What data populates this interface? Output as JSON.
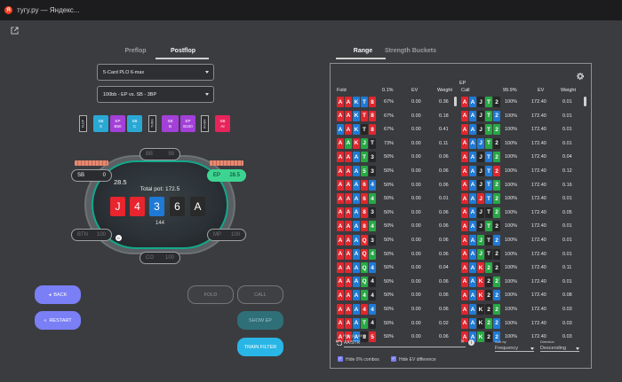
{
  "window": {
    "title": "тугу.ру — Яндекс...",
    "logo": "Я"
  },
  "tabs": {
    "preflop": "Preflop",
    "postflop": "Postflop",
    "range": "Range",
    "buckets": "Strength Buckets"
  },
  "selects": {
    "game": "5-Card PLO 6-max",
    "spot": "100bb - EP vs. SB - 3BP"
  },
  "actions": {
    "flop": "FLOP",
    "turn": "TURN",
    "river": "RIVER",
    "items": [
      {
        "l1": "SB",
        "l2": "X",
        "color": "#2aa8d4"
      },
      {
        "l1": "EP",
        "l2": "B50",
        "color": "#a340d8"
      },
      {
        "l1": "SB",
        "l2": "C",
        "color": "#2aa8d4"
      },
      {
        "l1": "SB",
        "l2": "B",
        "color": "#a340d8"
      },
      {
        "l1": "EP",
        "l2": "B100",
        "color": "#a340d8"
      },
      {
        "l1": "EP",
        "l2": "C",
        "color": "#2aa8d4"
      },
      {
        "l1": "SB",
        "l2": "AI",
        "color": "#e8245a"
      }
    ]
  },
  "seats": {
    "bb": {
      "name": "BB",
      "stack": "99"
    },
    "sb": {
      "name": "SB",
      "stack": "0"
    },
    "ep": {
      "name": "EP",
      "stack": "28.5"
    },
    "bth": {
      "name": "BTN",
      "stack": "100"
    },
    "mp": {
      "name": "MP",
      "stack": "100"
    },
    "co": {
      "name": "CO",
      "stack": "100"
    }
  },
  "table": {
    "left_bet": "28.5",
    "pot_label": "Total pot: 172.5",
    "pot": "144",
    "dealer": "D",
    "board": [
      {
        "r": "J",
        "c": "#e8242e"
      },
      {
        "r": "4",
        "c": "#e8242e"
      },
      {
        "r": "3",
        "c": "#1f7ad6"
      },
      {
        "r": "6",
        "c": "#2a2a2a"
      },
      {
        "r": "A",
        "c": "#2a2a2a"
      }
    ]
  },
  "buttons": {
    "back": "BACK",
    "restart": "RESTART",
    "fold": "FOLD",
    "call": "CALL",
    "show_ep": "SHOW EP",
    "train": "TRAIN FILTER"
  },
  "panel": {
    "fold_hdr": "Fold",
    "fold_pct": "0.1%",
    "ev": "EV",
    "weight": "Weight",
    "ep": "EP",
    "call_hdr": "Call",
    "call_pct": "99.9%",
    "ev2": "EV",
    "weight2": "Weight",
    "filter_label": "Filter (12.64%)",
    "filter_value": "AA!STR",
    "sort_label": "Sort by",
    "sort_value": "Frequency",
    "dir_label": "Direction",
    "dir_value": "Descending",
    "hide0": "Hide 0% combos",
    "hideev": "Hide EV difference"
  },
  "rows": [
    {
      "h": [
        "A",
        "A",
        "K",
        "T",
        "8"
      ],
      "c": [
        "r",
        "r",
        "b",
        "b",
        "r"
      ],
      "fp": "67%",
      "fe": "0.00",
      "fw": "0.36",
      "ch": [
        "A",
        "A",
        "J",
        "T",
        "2"
      ],
      "cc": [
        "r",
        "b",
        "k",
        "g",
        "k"
      ],
      "cp": "100%",
      "ce": "172.40",
      "cw": "0.01"
    },
    {
      "h": [
        "A",
        "A",
        "K",
        "T",
        "8"
      ],
      "c": [
        "r",
        "r",
        "b",
        "r",
        "r"
      ],
      "fp": "67%",
      "fe": "0.00",
      "fw": "0.18",
      "ch": [
        "A",
        "A",
        "J",
        "T",
        "2"
      ],
      "cc": [
        "r",
        "b",
        "k",
        "g",
        "b"
      ],
      "cp": "100%",
      "ce": "172.40",
      "cw": "0.01"
    },
    {
      "h": [
        "A",
        "A",
        "K",
        "T",
        "8"
      ],
      "c": [
        "b",
        "r",
        "b",
        "k",
        "r"
      ],
      "fp": "67%",
      "fe": "0.00",
      "fw": "0.41",
      "ch": [
        "A",
        "A",
        "J",
        "T",
        "2"
      ],
      "cc": [
        "r",
        "b",
        "k",
        "g",
        "g"
      ],
      "cp": "100%",
      "ce": "172.40",
      "cw": "0.01"
    },
    {
      "h": [
        "A",
        "A",
        "K",
        "J",
        "T"
      ],
      "c": [
        "r",
        "g",
        "r",
        "g",
        "k"
      ],
      "fp": "73%",
      "fe": "0.00",
      "fw": "0.11",
      "ch": [
        "A",
        "A",
        "J",
        "T",
        "2"
      ],
      "cc": [
        "r",
        "b",
        "b",
        "g",
        "k"
      ],
      "cp": "100%",
      "ce": "172.40",
      "cw": "0.01"
    },
    {
      "h": [
        "A",
        "A",
        "A",
        "T",
        "3"
      ],
      "c": [
        "r",
        "r",
        "b",
        "g",
        "k"
      ],
      "fp": "50%",
      "fe": "0.00",
      "fw": "0.06",
      "ch": [
        "A",
        "A",
        "J",
        "T",
        "2"
      ],
      "cc": [
        "r",
        "b",
        "k",
        "b",
        "g"
      ],
      "cp": "100%",
      "ce": "172.40",
      "cw": "0.04"
    },
    {
      "h": [
        "A",
        "A",
        "A",
        "5",
        "3"
      ],
      "c": [
        "r",
        "r",
        "b",
        "g",
        "k"
      ],
      "fp": "50%",
      "fe": "0.00",
      "fw": "0.06",
      "ch": [
        "A",
        "A",
        "J",
        "T",
        "2"
      ],
      "cc": [
        "r",
        "b",
        "k",
        "b",
        "r"
      ],
      "cp": "100%",
      "ce": "172.40",
      "cw": "0.12"
    },
    {
      "h": [
        "A",
        "A",
        "A",
        "6",
        "4"
      ],
      "c": [
        "r",
        "r",
        "b",
        "r",
        "b"
      ],
      "fp": "50%",
      "fe": "0.00",
      "fw": "0.06",
      "ch": [
        "A",
        "A",
        "J",
        "T",
        "2"
      ],
      "cc": [
        "r",
        "b",
        "k",
        "b",
        "g"
      ],
      "cp": "100%",
      "ce": "172.40",
      "cw": "0.16"
    },
    {
      "h": [
        "A",
        "A",
        "A",
        "6",
        "4"
      ],
      "c": [
        "r",
        "r",
        "b",
        "r",
        "g"
      ],
      "fp": "50%",
      "fe": "0.00",
      "fw": "0.01",
      "ch": [
        "A",
        "A",
        "J",
        "T",
        "2"
      ],
      "cc": [
        "r",
        "b",
        "r",
        "b",
        "g"
      ],
      "cp": "100%",
      "ce": "172.40",
      "cw": "0.01"
    },
    {
      "h": [
        "A",
        "A",
        "A",
        "8",
        "3"
      ],
      "c": [
        "r",
        "r",
        "b",
        "r",
        "k"
      ],
      "fp": "50%",
      "fe": "0.00",
      "fw": "0.06",
      "ch": [
        "A",
        "A",
        "J",
        "T",
        "2"
      ],
      "cc": [
        "r",
        "b",
        "k",
        "k",
        "g"
      ],
      "cp": "100%",
      "ce": "172.40",
      "cw": "0.05"
    },
    {
      "h": [
        "A",
        "A",
        "A",
        "8",
        "4"
      ],
      "c": [
        "r",
        "r",
        "b",
        "r",
        "g"
      ],
      "fp": "50%",
      "fe": "0.00",
      "fw": "0.06",
      "ch": [
        "A",
        "A",
        "J",
        "T",
        "2"
      ],
      "cc": [
        "r",
        "b",
        "k",
        "g",
        "k"
      ],
      "cp": "100%",
      "ce": "172.40",
      "cw": "0.01"
    },
    {
      "h": [
        "A",
        "A",
        "A",
        "Q",
        "3"
      ],
      "c": [
        "r",
        "r",
        "b",
        "r",
        "k"
      ],
      "fp": "50%",
      "fe": "0.00",
      "fw": "0.06",
      "ch": [
        "A",
        "A",
        "J",
        "T",
        "2"
      ],
      "cc": [
        "r",
        "b",
        "g",
        "k",
        "b"
      ],
      "cp": "100%",
      "ce": "172.40",
      "cw": "0.01"
    },
    {
      "h": [
        "A",
        "A",
        "A",
        "Q",
        "4"
      ],
      "c": [
        "r",
        "r",
        "b",
        "r",
        "g"
      ],
      "fp": "50%",
      "fe": "0.00",
      "fw": "0.06",
      "ch": [
        "A",
        "A",
        "J",
        "T",
        "2"
      ],
      "cc": [
        "r",
        "b",
        "g",
        "k",
        "k"
      ],
      "cp": "100%",
      "ce": "172.40",
      "cw": "0.01"
    },
    {
      "h": [
        "A",
        "A",
        "A",
        "Q",
        "4"
      ],
      "c": [
        "r",
        "r",
        "b",
        "g",
        "b"
      ],
      "fp": "50%",
      "fe": "0.00",
      "fw": "0.04",
      "ch": [
        "A",
        "A",
        "K",
        "2",
        "2"
      ],
      "cc": [
        "r",
        "b",
        "r",
        "g",
        "k"
      ],
      "cp": "100%",
      "ce": "172.40",
      "cw": "0.11"
    },
    {
      "h": [
        "A",
        "A",
        "A",
        "Q",
        "4"
      ],
      "c": [
        "r",
        "r",
        "b",
        "g",
        "k"
      ],
      "fp": "50%",
      "fe": "0.00",
      "fw": "0.06",
      "ch": [
        "A",
        "A",
        "K",
        "2",
        "2"
      ],
      "cc": [
        "r",
        "b",
        "r",
        "k",
        "g"
      ],
      "cp": "100%",
      "ce": "172.40",
      "cw": "0.01"
    },
    {
      "h": [
        "A",
        "A",
        "A",
        "4",
        "4"
      ],
      "c": [
        "r",
        "r",
        "b",
        "g",
        "k"
      ],
      "fp": "50%",
      "fe": "0.00",
      "fw": "0.06",
      "ch": [
        "A",
        "A",
        "K",
        "2",
        "2"
      ],
      "cc": [
        "r",
        "b",
        "r",
        "k",
        "b"
      ],
      "cp": "100%",
      "ce": "172.40",
      "cw": "0.08"
    },
    {
      "h": [
        "A",
        "A",
        "A",
        "4",
        "4"
      ],
      "c": [
        "r",
        "r",
        "b",
        "r",
        "b"
      ],
      "fp": "50%",
      "fe": "0.00",
      "fw": "0.06",
      "ch": [
        "A",
        "A",
        "K",
        "2",
        "2"
      ],
      "cc": [
        "r",
        "b",
        "k",
        "k",
        "g"
      ],
      "cp": "100%",
      "ce": "172.40",
      "cw": "0.03"
    },
    {
      "h": [
        "A",
        "A",
        "A",
        "T",
        "4"
      ],
      "c": [
        "r",
        "r",
        "b",
        "g",
        "k"
      ],
      "fp": "50%",
      "fe": "0.00",
      "fw": "0.02",
      "ch": [
        "A",
        "A",
        "K",
        "2",
        "2"
      ],
      "cc": [
        "r",
        "b",
        "k",
        "g",
        "b"
      ],
      "cp": "100%",
      "ce": "172.40",
      "cw": "0.03"
    },
    {
      "h": [
        "A",
        "A",
        "A",
        "8",
        "5"
      ],
      "c": [
        "r",
        "r",
        "b",
        "k",
        "r"
      ],
      "fp": "50%",
      "fe": "0.00",
      "fw": "0.06",
      "ch": [
        "A",
        "A",
        "K",
        "2",
        "2"
      ],
      "cc": [
        "r",
        "b",
        "g",
        "k",
        "b"
      ],
      "cp": "100%",
      "ce": "172.40",
      "cw": "0.03"
    }
  ],
  "colors": {
    "r": "#e0262e",
    "b": "#1f7ad6",
    "g": "#27a845",
    "k": "#262626"
  }
}
